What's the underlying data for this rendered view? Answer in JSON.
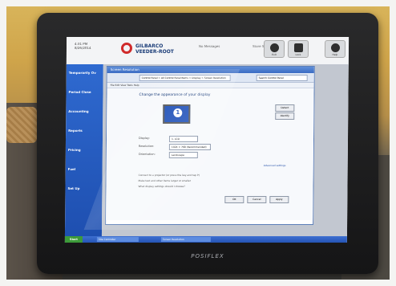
{
  "header": {
    "time": "4:31 PM",
    "date": "8/26/2014",
    "logo_line1": "GILBARCO",
    "logo_line2": "VEEDER-ROOT",
    "mid_text": "No Messages",
    "right_text": "Store Status",
    "help_label": "Help",
    "lock_label": "Lock",
    "user_label": "Exit"
  },
  "sidebar": {
    "items": [
      {
        "label": "Temporarily Ov"
      },
      {
        "label": "Period Close"
      },
      {
        "label": "Accounting"
      },
      {
        "label": "Reports"
      },
      {
        "label": "Pricing"
      },
      {
        "label": "Fuel"
      },
      {
        "label": "Set Up"
      }
    ]
  },
  "window": {
    "title": "Screen Resolution",
    "address": "Control Panel > All Control Panel Items > Display > Screen Resolution",
    "search_placeholder": "Search Control Panel",
    "menu": "File  Edit  View  Tools  Help",
    "heading": "Change the appearance of your display",
    "monitor_number": "1",
    "detect_label": "Detect",
    "identify_label": "Identify",
    "display_label": "Display:",
    "display_value": "1. LCD",
    "resolution_label": "Resolution:",
    "resolution_value": "1024 × 768 (Recommended)",
    "orientation_label": "Orientation:",
    "orientation_value": "Landscape",
    "advanced_link": "Advanced settings",
    "line1": "Connect to a projector (or press the  key and tap P)",
    "line2": "Make text and other items larger or smaller",
    "line3": "What display settings should I choose?",
    "ok_label": "OK",
    "cancel_label": "Cancel",
    "apply_label": "Apply"
  },
  "taskbar": {
    "start_label": "Start",
    "task1": "Site Controller",
    "task2": "Screen Resolution"
  },
  "bezel": {
    "brand": "POSIFLEX"
  }
}
